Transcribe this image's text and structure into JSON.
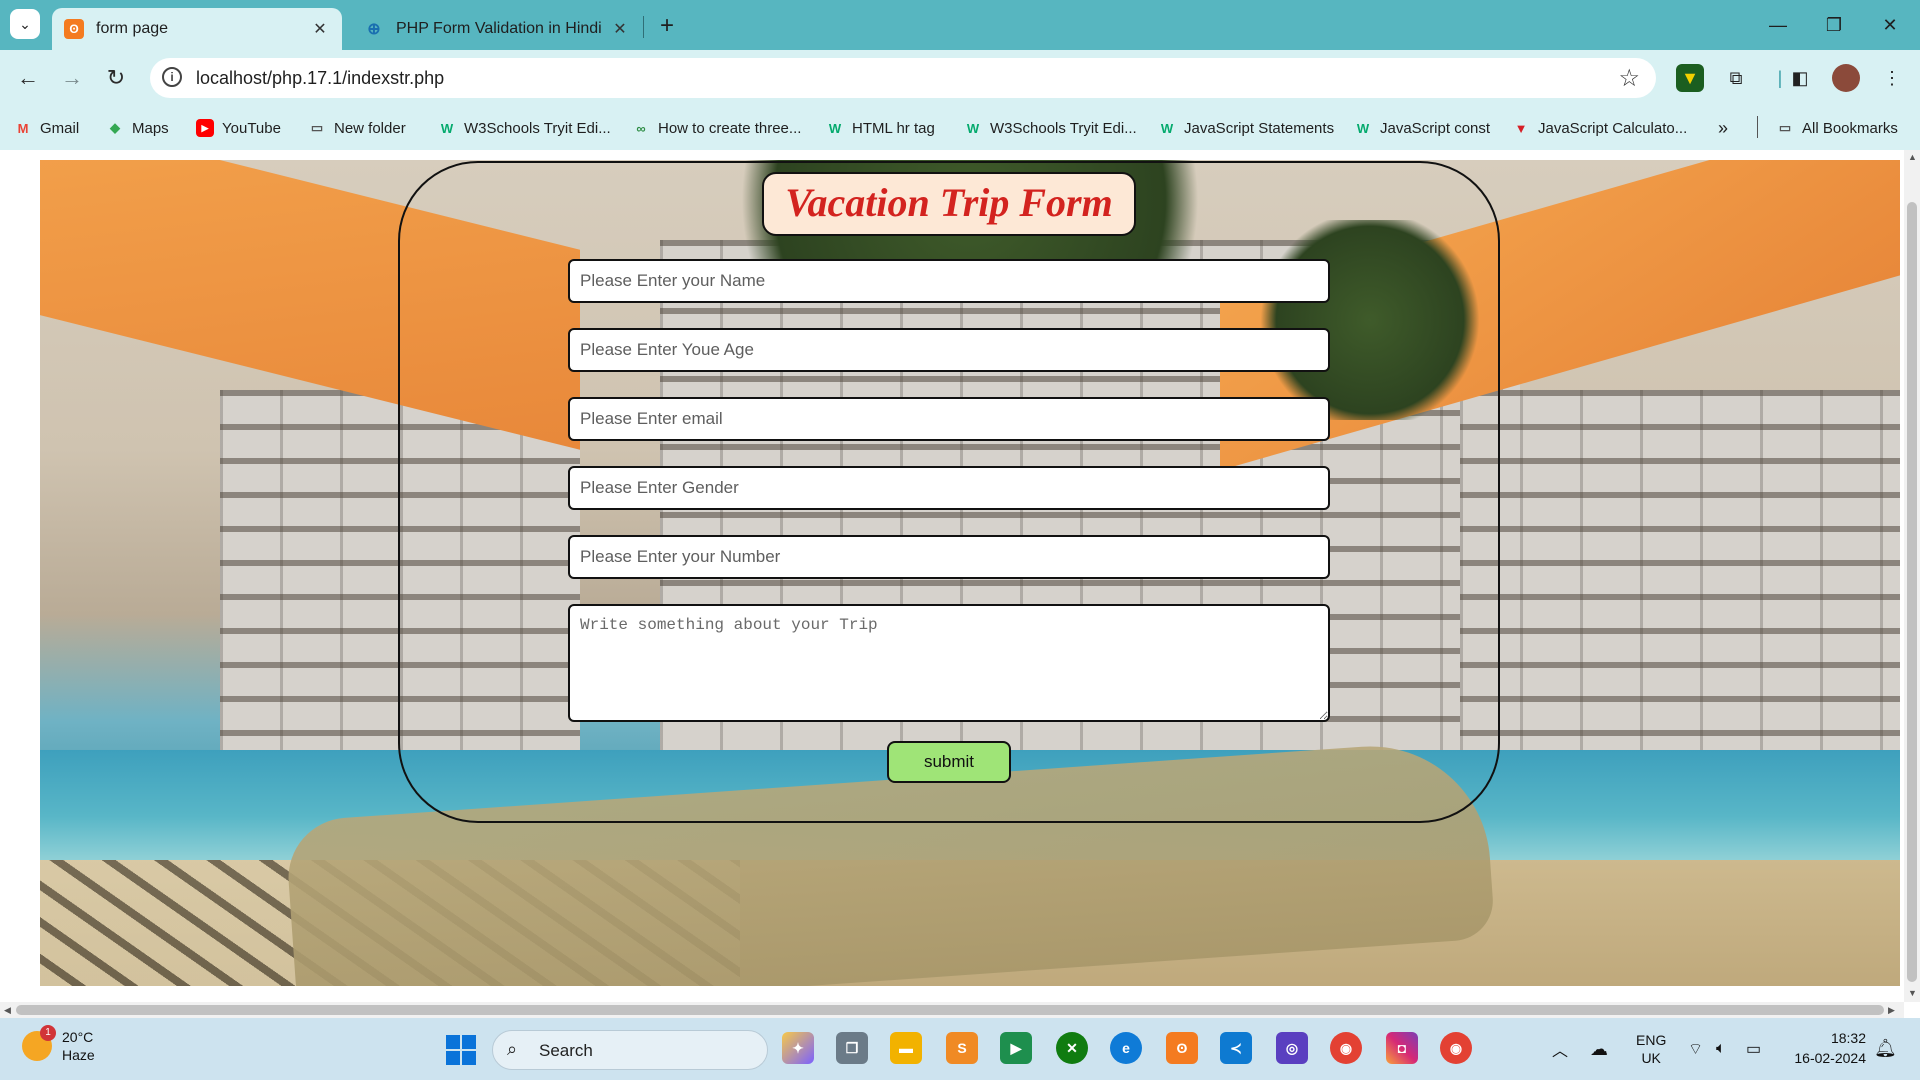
{
  "browser": {
    "tabs": [
      {
        "title": "form page",
        "favicon": "xampp-icon",
        "active": true
      },
      {
        "title": "PHP Form Validation in Hindi",
        "favicon": "php-tutorial-icon",
        "active": false
      }
    ],
    "url": "localhost/php.17.1/indexstr.php",
    "bookmarks": [
      {
        "label": "Gmail",
        "icon": "gmail-icon",
        "color": "#ea4335"
      },
      {
        "label": "Maps",
        "icon": "maps-icon",
        "color": "#34a853"
      },
      {
        "label": "YouTube",
        "icon": "youtube-icon",
        "color": "#ff0000"
      },
      {
        "label": "New folder",
        "icon": "folder-icon",
        "color": "#555555"
      },
      {
        "label": "W3Schools Tryit Edi...",
        "icon": "w3schools-icon",
        "color": "#04aa6d"
      },
      {
        "label": "How to create three...",
        "icon": "geeksforgeeks-icon",
        "color": "#2f8d46"
      },
      {
        "label": "HTML hr tag",
        "icon": "w3schools-icon",
        "color": "#04aa6d"
      },
      {
        "label": "W3Schools Tryit Edi...",
        "icon": "w3schools-icon",
        "color": "#04aa6d"
      },
      {
        "label": "JavaScript Statements",
        "icon": "w3schools-icon",
        "color": "#04aa6d"
      },
      {
        "label": "JavaScript const",
        "icon": "w3schools-icon",
        "color": "#04aa6d"
      },
      {
        "label": "JavaScript Calculato...",
        "icon": "vite-icon",
        "color": "#d61f26"
      }
    ],
    "more_bookmarks": "»",
    "all_bookmarks": "All Bookmarks"
  },
  "form": {
    "title": "Vacation Trip Form",
    "name_placeholder": "Please Enter your Name",
    "age_placeholder": "Please Enter Youe Age",
    "email_placeholder": "Please Enter email",
    "gender_placeholder": "Please Enter Gender",
    "number_placeholder": "Please Enter your Number",
    "trip_placeholder": "Write something about your Trip",
    "submit_label": "submit"
  },
  "taskbar": {
    "weather_temp": "20°C",
    "weather_desc": "Haze",
    "weather_badge": "1",
    "search_label": "Search",
    "language_line1": "ENG",
    "language_line2": "UK",
    "time": "18:32",
    "date": "16-02-2024"
  },
  "colors": {
    "tabstrip": "#57b6c0",
    "toolbar": "#d8f1f3",
    "form_title_text": "#d3231f",
    "form_title_bg": "#fde8d6",
    "submit_bg": "#9fe477"
  }
}
